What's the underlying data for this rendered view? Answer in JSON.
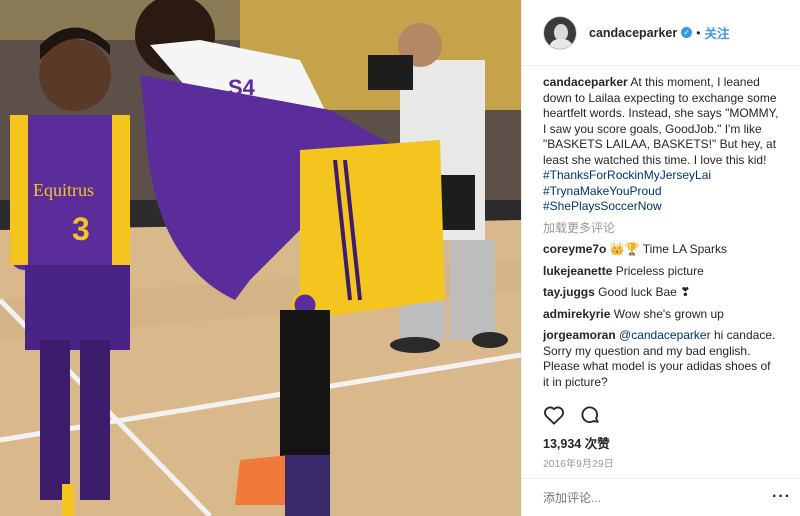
{
  "header": {
    "username": "candaceparker",
    "verified_glyph": "✓",
    "separator": "•",
    "follow_label": "关注"
  },
  "caption": {
    "username": "candaceparker",
    "text": "At this moment, I leaned down to Lailaa expecting to exchange some heartfelt words. Instead, she says \"MOMMY, I saw you score goals, GoodJob.\" I'm like \"BASKETS LAILAA, BASKETS!\" But hey, at least she watched this time. I love this kid!",
    "hashtags": [
      "#ThanksForRockinMyJerseyLai",
      "#TrynaMakeYouProud",
      "#ShePlaysSoccerNow"
    ]
  },
  "load_more_label": "加载更多评论",
  "comments": [
    {
      "username": "coreyme7o",
      "text": "👑🏆 Time LA Sparks"
    },
    {
      "username": "lukejeanette",
      "text": "Priceless picture"
    },
    {
      "username": "tay.juggs",
      "text": "Good luck Bae ❣"
    },
    {
      "username": "admirekyrie",
      "text": "Wow she's grown up"
    },
    {
      "username": "jorgeamoran",
      "mention": "@candaceparker",
      "text": "hi candace. Sorry my question and my bad english. Please what model is your adidas shoes of it in picture?"
    }
  ],
  "actions": {
    "like_icon": "heart-icon",
    "comment_icon": "comment-bubble-icon"
  },
  "likes_count": "13,934 次赞",
  "date": "2016年9月29日",
  "comment_input": {
    "placeholder": "添加评论..."
  },
  "more_options": "···",
  "photo": {
    "jersey_child_text": "Equitrus",
    "jersey_child_number": "3",
    "towel_text": "S4",
    "colors": {
      "purple": "#5b2d9a",
      "gold": "#f4c51e",
      "court": "#d9b98c"
    }
  }
}
